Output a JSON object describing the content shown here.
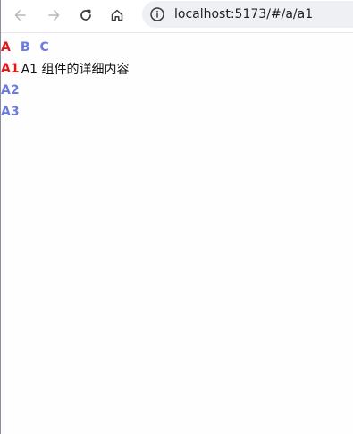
{
  "browser": {
    "url": "localhost:5173/#/a/a1",
    "icons": {
      "back": "arrow-left-icon",
      "forward": "arrow-right-icon",
      "reload": "reload-icon",
      "home": "home-icon",
      "site_info": "site-info-icon"
    }
  },
  "colors": {
    "active_link": "#e01818",
    "inactive_link": "#6b7be0",
    "text": "#111111"
  },
  "nav": {
    "items": [
      {
        "label": "A",
        "active": true
      },
      {
        "label": "B",
        "active": false
      },
      {
        "label": "C",
        "active": false
      }
    ]
  },
  "subnav": {
    "items": [
      {
        "label": "A1",
        "active": true
      },
      {
        "label": "A2",
        "active": false
      },
      {
        "label": "A3",
        "active": false
      }
    ],
    "detail": "A1 组件的详细内容"
  }
}
